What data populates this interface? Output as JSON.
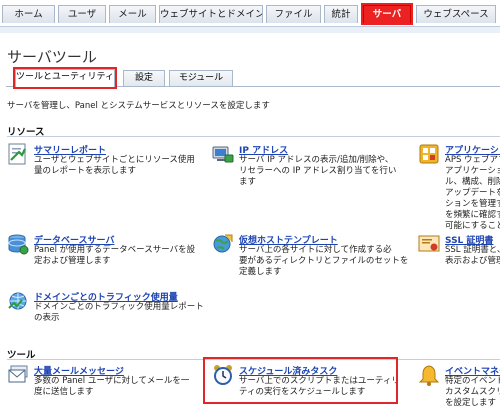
{
  "nav": {
    "tabs": [
      {
        "label": "ホーム"
      },
      {
        "label": "ユーザ"
      },
      {
        "label": "メール"
      },
      {
        "label": "ウェブサイトとドメイン"
      },
      {
        "label": "ファイル"
      },
      {
        "label": "統計"
      },
      {
        "label": "サーバ"
      },
      {
        "label": "ウェブスペース"
      }
    ],
    "active_tab": "サーバ"
  },
  "page": {
    "title": "サーバツール",
    "description": "サーバを管理し、Panel とシステムサービスとリソースを設定します"
  },
  "subtabs": [
    {
      "label": "ツールとユーティリティ"
    },
    {
      "label": "設定"
    },
    {
      "label": "モジュール"
    }
  ],
  "sections": {
    "resources": "リソース",
    "tools": "ツール"
  },
  "resources": [
    {
      "title": "サマリーレポート",
      "desc": "ユーザとウェブサイトごとにリソース使用\n量のレポートを表示します",
      "icon": "summary-report-icon"
    },
    {
      "title": "IP アドレス",
      "desc": "サーバ IP アドレスの表示/追加/削除や、\nリセラーへの IP アドレス割り当てを行い\nます",
      "icon": "ip-address-icon"
    },
    {
      "title": "アプリケーショ",
      "desc": "APS ウェブアプ\nアプリケーショ\nル、構成、削除\nアップデートを\nションを管理す\nを頻繁に確認す\n可能にすること",
      "icon": "application-icon"
    },
    {
      "title": "データベースサーバ",
      "desc": "Panel が使用するデータベースサーバを設\n定および管理します",
      "icon": "database-server-icon"
    },
    {
      "title": "仮想ホストテンプレート",
      "desc": "サーバ上の各サイトに対して作成する必\n要があるディレクトリとファイルのセットを\n定義します",
      "icon": "virtual-host-template-icon"
    },
    {
      "title": "SSL 証明書",
      "desc": "SSL 証明書と、P\n表示および管理",
      "icon": "ssl-certificate-icon"
    },
    {
      "title": "ドメインごとのトラフィック使用量",
      "desc": "ドメインごとのトラフィック使用量レポート\nの表示",
      "icon": "traffic-usage-icon"
    }
  ],
  "tools": [
    {
      "title": "大量メールメッセージ",
      "desc": "多数の Panel ユーザに対してメールを一\n度に送信します",
      "icon": "mass-mail-icon"
    },
    {
      "title": "スケジュール済みタスク",
      "desc": "サーバ上でのスクリプトまたはユーティリ\nティの実行をスケジュールします",
      "icon": "scheduled-tasks-icon"
    },
    {
      "title": "イベントマネー",
      "desc": "特定のイベント\nカスタムスクリ\nを設定します",
      "icon": "event-manager-icon"
    }
  ]
}
